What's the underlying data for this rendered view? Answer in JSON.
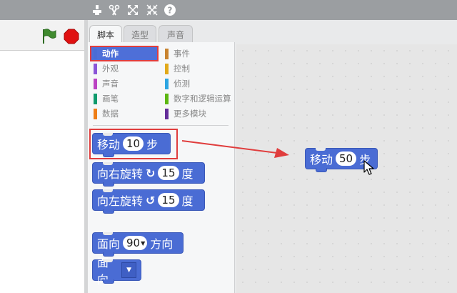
{
  "toolbar": {
    "icons": [
      "duplicate-icon",
      "delete-icon",
      "grow-icon",
      "shrink-icon",
      "help-icon"
    ],
    "help_label": "?"
  },
  "tabs": [
    {
      "label": "脚本",
      "active": true
    },
    {
      "label": "造型",
      "active": false
    },
    {
      "label": "声音",
      "active": false
    }
  ],
  "categories": {
    "left": [
      {
        "label": "动作",
        "color": "#4a6cd4",
        "selected": true
      },
      {
        "label": "外观",
        "color": "#8a55d7"
      },
      {
        "label": "声音",
        "color": "#bb42c3"
      },
      {
        "label": "画笔",
        "color": "#0e9a6c"
      },
      {
        "label": "数据",
        "color": "#ee7d16"
      }
    ],
    "right": [
      {
        "label": "事件",
        "color": "#c88330"
      },
      {
        "label": "控制",
        "color": "#e1a91a"
      },
      {
        "label": "侦测",
        "color": "#2ca5e2"
      },
      {
        "label": "数字和逻辑运算",
        "color": "#5cb712"
      },
      {
        "label": "更多模块",
        "color": "#632d99"
      }
    ]
  },
  "palette_blocks": {
    "move": {
      "prefix": "移动",
      "value": "10",
      "suffix": "步"
    },
    "turn_right": {
      "prefix": "向右旋转",
      "symbol": "↻",
      "value": "15",
      "suffix": "度"
    },
    "turn_left": {
      "prefix": "向左旋转",
      "symbol": "↺",
      "value": "15",
      "suffix": "度"
    },
    "point_dir": {
      "prefix": "面向",
      "value": "90",
      "suffix": "方向"
    },
    "point_towards": {
      "prefix": "面向"
    }
  },
  "script_block": {
    "prefix": "移动",
    "value": "50",
    "suffix": "步"
  },
  "colors": {
    "motion": "#4a6cd4",
    "highlight": "#e03d3d",
    "stop": "#e01010",
    "flag": "#3f8a2e"
  }
}
